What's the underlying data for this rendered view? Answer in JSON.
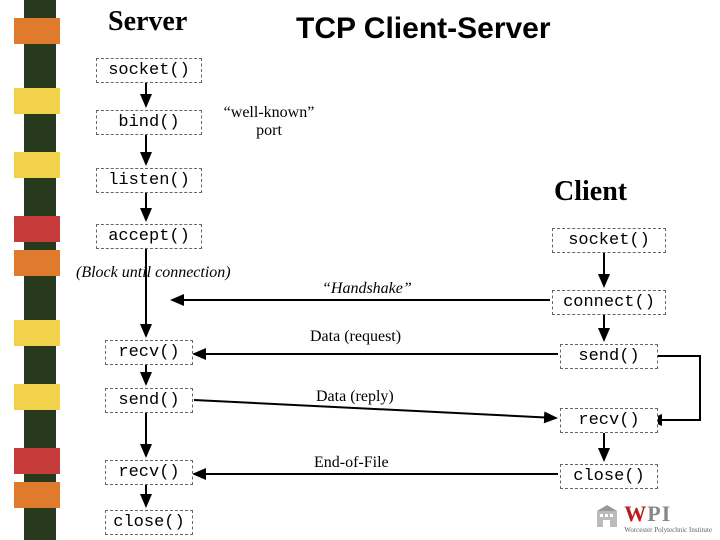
{
  "title": "TCP Client-Server",
  "server": {
    "heading": "Server",
    "steps": [
      "socket()",
      "bind()",
      "listen()",
      "accept()",
      "recv()",
      "send()",
      "recv()",
      "close()"
    ],
    "block_note": "(Block until connection)",
    "port_note_l1": "“well-known”",
    "port_note_l2": "port"
  },
  "client": {
    "heading": "Client",
    "steps": [
      "socket()",
      "connect()",
      "send()",
      "recv()",
      "close()"
    ]
  },
  "exchanges": {
    "handshake": "“Handshake”",
    "request": "Data (request)",
    "reply": "Data (reply)",
    "eof": "End-of-File"
  },
  "logo": {
    "w": "W",
    "pi": "PI",
    "inst": "Worcester Polytechnic Institute"
  }
}
